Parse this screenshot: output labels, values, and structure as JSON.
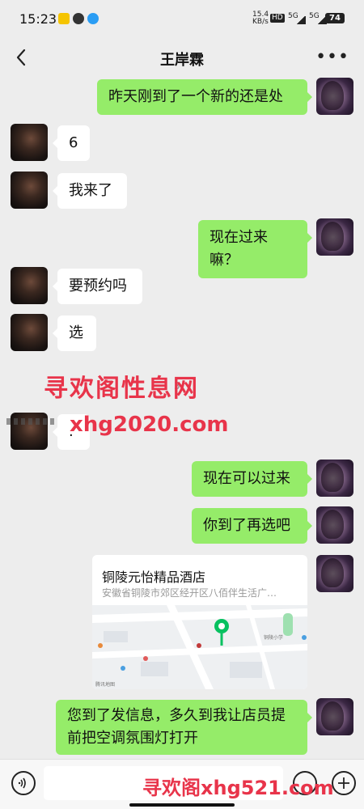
{
  "status_bar": {
    "time": "15:23",
    "net_speed": "15.4\nKB/s",
    "hd": "HD",
    "sig1": "5G",
    "sig2": "5G",
    "battery": "74"
  },
  "nav": {
    "back_icon": "chevron-left-icon",
    "title": "王岸霖",
    "more_label": "•••"
  },
  "messages": [
    {
      "side": "right",
      "text": "昨天刚到了一个新的还是处"
    },
    {
      "side": "left",
      "text": "6"
    },
    {
      "side": "left",
      "text": "我来了"
    },
    {
      "side": "right",
      "text": "现在过来嘛？"
    },
    {
      "side": "left",
      "text": "要预约吗"
    },
    {
      "side": "left",
      "text": "选"
    },
    {
      "side": "left",
      "text": "."
    },
    {
      "side": "right",
      "text": "现在可以过来"
    },
    {
      "side": "right",
      "text": "你到了再选吧"
    },
    {
      "side": "right",
      "text": "您到了发信息，多久到我让店员提前把空调氛围灯打开"
    }
  ],
  "location": {
    "name": "铜陵元怡精品酒店",
    "address": "安徽省铜陵市郊区经开区八佰伴生活广…",
    "map_labels": {
      "school": "铜陵小学",
      "tag": "腾讯地图"
    }
  },
  "watermarks": {
    "line1": "寻欢阁性息网",
    "line2": "xhg2020.com",
    "bottom": "寻欢阁xhg521.com",
    "faint_number": "3"
  },
  "colors": {
    "accent_green": "#95ec69",
    "background": "#ededed",
    "watermark_red": "#e8344a",
    "pin_green": "#07c160"
  },
  "input_bar": {
    "voice_icon": "voice-icon",
    "emoji_icon": "emoji-icon",
    "plus_icon": "plus-icon"
  }
}
